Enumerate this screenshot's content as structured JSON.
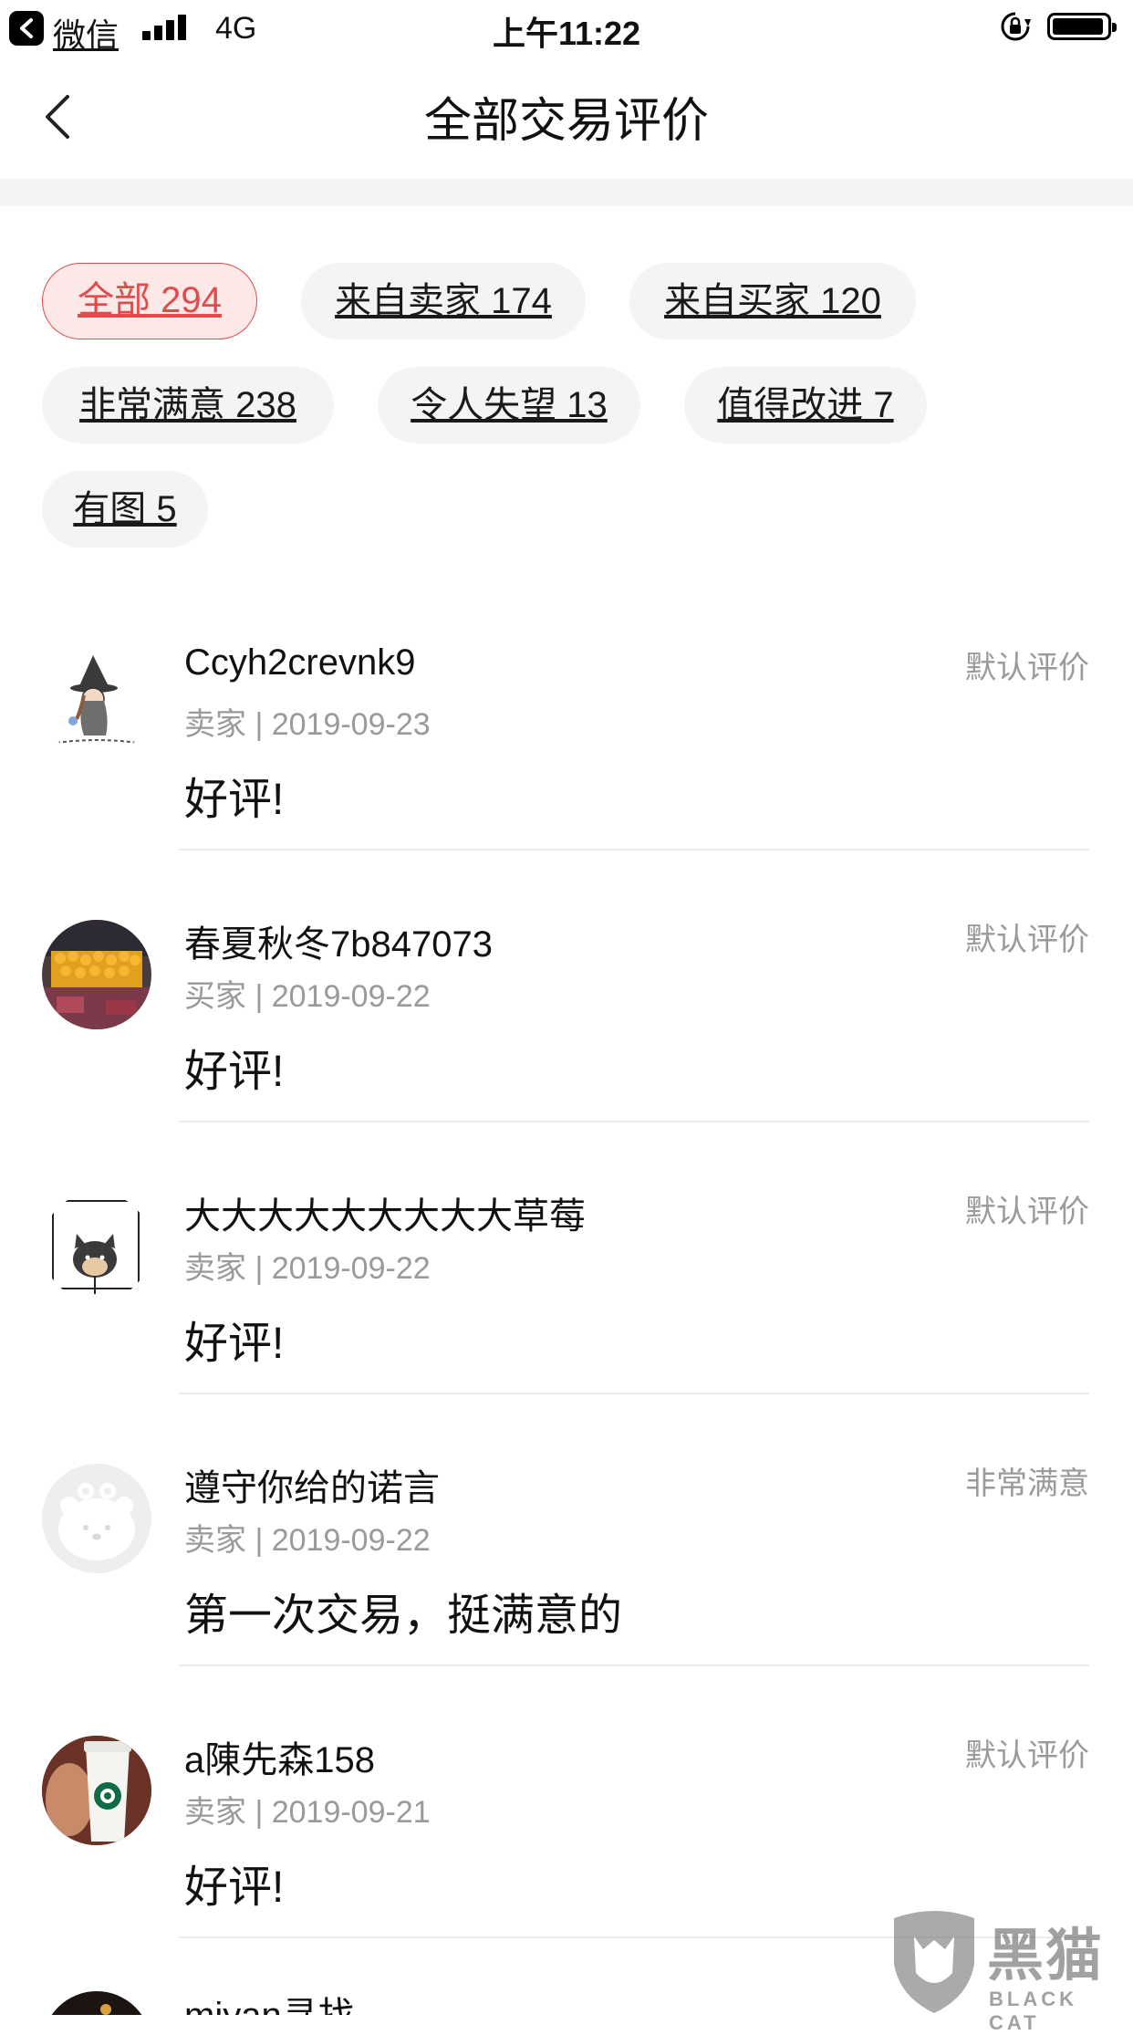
{
  "status_bar": {
    "back_app": "微信",
    "network": "4G",
    "time": "上午11:22"
  },
  "nav": {
    "title": "全部交易评价"
  },
  "filters": [
    {
      "label": "全部 294",
      "active": true
    },
    {
      "label": "来自卖家 174",
      "active": false
    },
    {
      "label": "来自买家 120",
      "active": false
    },
    {
      "label": "非常满意 238",
      "active": false
    },
    {
      "label": "令人失望 13",
      "active": false
    },
    {
      "label": "值得改进 7",
      "active": false
    },
    {
      "label": "有图 5",
      "active": false
    }
  ],
  "reviews": [
    {
      "user": "Ccyh2crevnk9",
      "meta": "卖家 | 2019-09-23",
      "tag": "默认评价",
      "text": "好评!"
    },
    {
      "user": "春夏秋冬7b847073",
      "meta": "买家 | 2019-09-22",
      "tag": "默认评价",
      "text": "好评!"
    },
    {
      "user": "大大大大大大大大大草莓",
      "meta": "卖家 | 2019-09-22",
      "tag": "默认评价",
      "text": "好评!"
    },
    {
      "user": "遵守你给的诺言",
      "meta": "卖家 | 2019-09-22",
      "tag": "非常满意",
      "text": "第一次交易，挺满意的"
    },
    {
      "user": "a陳先森158",
      "meta": "卖家 | 2019-09-21",
      "tag": "默认评价",
      "text": "好评!"
    },
    {
      "user": "miyan寻找",
      "meta": "",
      "tag": "",
      "text": ""
    }
  ],
  "watermark": {
    "text": "黑猫",
    "sub": "BLACK CAT"
  },
  "colors": {
    "accent": "#e04b4b",
    "chip_bg": "#f4f4f4",
    "active_chip_bg": "#fde8e8",
    "muted_text": "#9a9a9a"
  }
}
